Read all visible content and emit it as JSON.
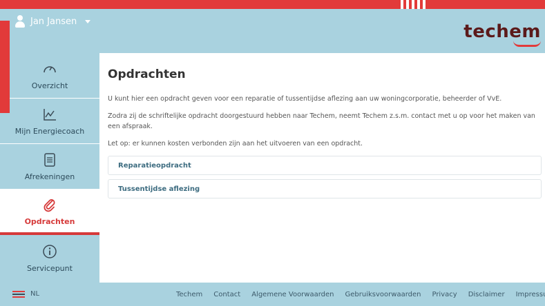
{
  "header": {
    "user_name": "Jan Jansen",
    "logo_text": "techem",
    "accent_color": "#e23a3a",
    "header_color": "#a9d2df"
  },
  "sidebar": {
    "items": [
      {
        "label": "Overzicht",
        "icon": "speedometer-icon"
      },
      {
        "label": "Mijn Energiecoach",
        "icon": "line-chart-icon"
      },
      {
        "label": "Afrekeningen",
        "icon": "document-icon"
      },
      {
        "label": "Opdrachten",
        "icon": "paperclip-icon",
        "active": true
      },
      {
        "label": "Servicepunt",
        "icon": "info-icon"
      }
    ]
  },
  "main": {
    "title": "Opdrachten",
    "paragraph1": "U kunt hier een opdracht geven voor een reparatie of tussentijdse aflezing aan uw woningcorporatie, beheerder of VvE.",
    "paragraph2": "Zodra zij de schriftelijke opdracht doorgestuurd hebben naar Techem, neemt Techem z.s.m. contact met u op voor het maken van een afspraak.",
    "paragraph3": "Let op: er kunnen kosten verbonden zijn aan het uitvoeren van een opdracht.",
    "links": [
      {
        "label": "Reparatieopdracht"
      },
      {
        "label": "Tussentijdse aflezing"
      }
    ]
  },
  "footer": {
    "language": "NL",
    "links": [
      "Techem",
      "Contact",
      "Algemene Voorwaarden",
      "Gebruiksvoorwaarden",
      "Privacy",
      "Disclaimer",
      "Impressum"
    ]
  }
}
